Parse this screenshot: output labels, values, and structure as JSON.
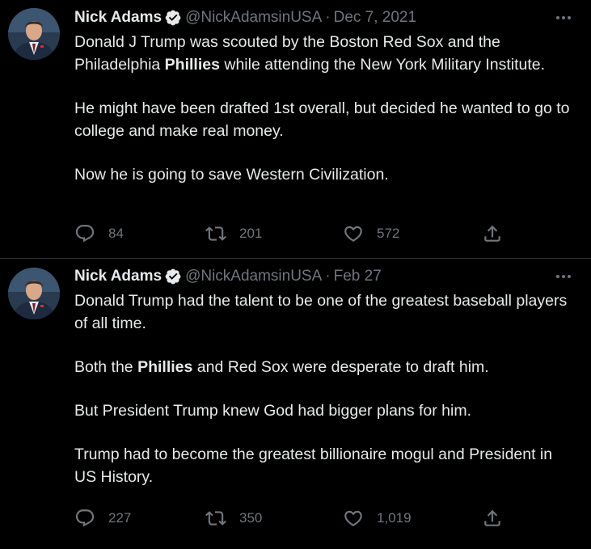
{
  "colors": {
    "background": "#000000",
    "text": "#e7e9ea",
    "secondary": "#71767b",
    "verified": "#e7e9ea",
    "divider": "#2f3336"
  },
  "tweets": [
    {
      "name": "Nick Adams",
      "handle": "@NickAdamsinUSA",
      "separator": "·",
      "date": "Dec 7, 2021",
      "paragraphs": [
        [
          {
            "text": "Donald J Trump was scouted by the Boston Red Sox and the Philadelphia ",
            "bold": false
          },
          {
            "text": "Phillies",
            "bold": true
          },
          {
            "text": " while attending the New York Military Institute.",
            "bold": false
          }
        ],
        [
          {
            "text": "He might have been drafted 1st overall, but decided he wanted to go to college and make real money.",
            "bold": false
          }
        ],
        [
          {
            "text": "Now he is going to save Western Civilization.",
            "bold": false
          }
        ]
      ],
      "replies": "84",
      "retweets": "201",
      "likes": "572"
    },
    {
      "name": "Nick Adams",
      "handle": "@NickAdamsinUSA",
      "separator": "·",
      "date": "Feb 27",
      "paragraphs": [
        [
          {
            "text": "Donald Trump had the talent to be one of the greatest baseball players of all time.",
            "bold": false
          }
        ],
        [
          {
            "text": "Both the ",
            "bold": false
          },
          {
            "text": "Phillies",
            "bold": true
          },
          {
            "text": " and Red Sox were desperate to draft him.",
            "bold": false
          }
        ],
        [
          {
            "text": "But President Trump knew God had bigger plans for him.",
            "bold": false
          }
        ],
        [
          {
            "text": "Trump had to become the greatest billionaire mogul and President in US History.",
            "bold": false
          }
        ]
      ],
      "replies": "227",
      "retweets": "350",
      "likes": "1,019"
    }
  ],
  "icons": {
    "verified": "verified-badge-icon",
    "more": "more-dots-icon",
    "reply": "reply-icon",
    "retweet": "retweet-icon",
    "like": "heart-icon",
    "share": "share-icon"
  }
}
